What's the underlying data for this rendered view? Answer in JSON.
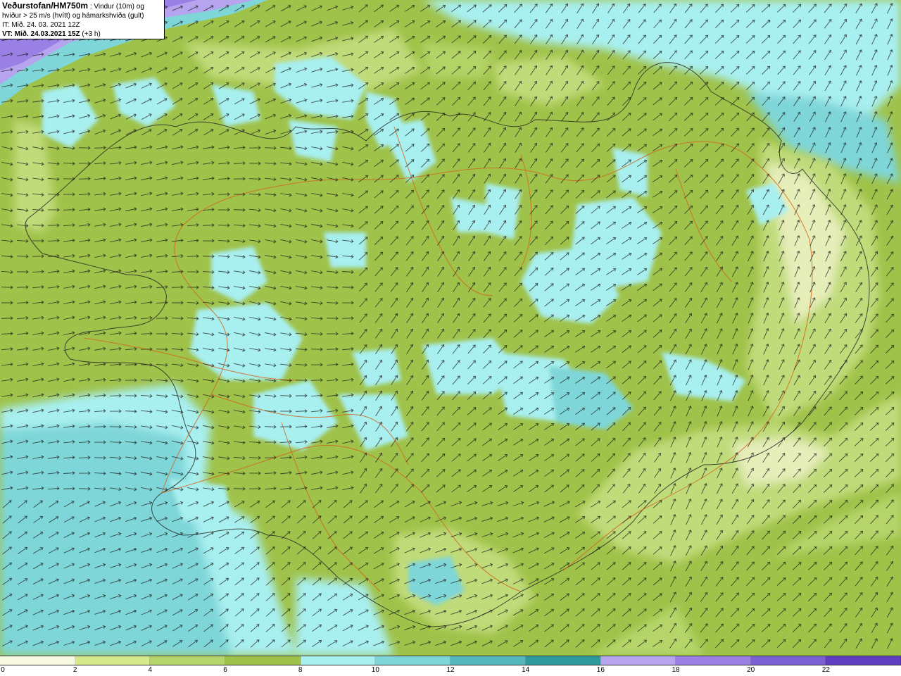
{
  "header": {
    "title": "Veðurstofan/HM750m",
    "description_line1": " : Vindur (10m) og",
    "description_line2": "hviður > 25 m/s (hvítt) og hámarkshviða (gult)",
    "it_line": "IT: Mið. 24. 03. 2021 12Z",
    "vt_label": "VT: Mið. 24.03.2021 15Z",
    "vt_offset": " (+3 h)"
  },
  "legend": {
    "tick_labels": [
      "0",
      "2",
      "4",
      "6",
      "8",
      "10",
      "12",
      "14",
      "16",
      "18",
      "20",
      "22"
    ],
    "colors": [
      "#f7f9e0",
      "#d6e98c",
      "#b5d56a",
      "#9fc24a",
      "#a8eff0",
      "#7fd6d8",
      "#55b8bc",
      "#2e9a9c",
      "#b7a4ee",
      "#9a80e4",
      "#7a60d2",
      "#5f3fc0"
    ]
  },
  "map_colors": {
    "land_green": "#9fc24a",
    "light_green": "#c4de80",
    "pale": "#eef3c6",
    "cyan": "#a8eff0",
    "teal": "#7fd6d8",
    "deep_teal": "#55b8bc",
    "purple": "#9a80e4",
    "road": "#d2661e",
    "coast": "#202020"
  },
  "arrows": {
    "direction": "wind-arrow-icon"
  }
}
